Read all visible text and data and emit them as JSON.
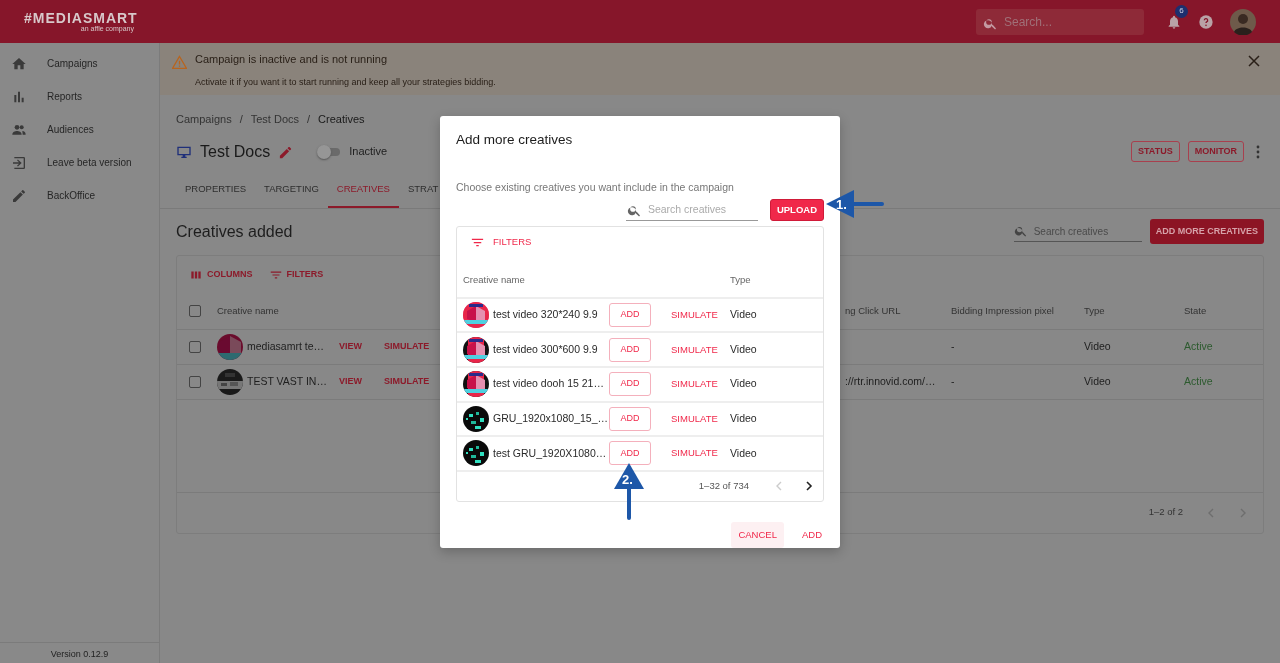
{
  "topbar": {
    "logo": "#MEDIASMART",
    "logo_tagline": "an affle company",
    "search": {
      "placeholder": "Search..."
    },
    "notifications_badge": "6"
  },
  "sidebar": {
    "items": [
      {
        "label": "Campaigns",
        "kind": "home"
      },
      {
        "label": "Reports",
        "kind": "chart"
      },
      {
        "label": "Audiences",
        "kind": "people"
      },
      {
        "label": "Leave beta version",
        "kind": "exit"
      },
      {
        "label": "BackOffice",
        "kind": "pencil"
      }
    ],
    "version": "Version 0.12.9"
  },
  "banner": {
    "title": "Campaign is inactive and is not running",
    "message": "Activate it if you want it to start running and keep all your strategies bidding."
  },
  "breadcrumb": {
    "items": [
      "Campaigns",
      "Test Docs",
      "Creatives"
    ],
    "separators": [
      "/",
      "/"
    ]
  },
  "campaign": {
    "title": "Test Docs",
    "active": false,
    "status_label": "Inactive"
  },
  "header_buttons": [
    "STATUS",
    "MONITOR"
  ],
  "tabs": [
    {
      "label": "PROPERTIES",
      "selected": false
    },
    {
      "label": "TARGETING",
      "selected": false
    },
    {
      "label": "CREATIVES",
      "selected": true
    },
    {
      "label": "STRAT",
      "selected": false
    }
  ],
  "section": {
    "title": "Creatives added",
    "search": {
      "placeholder": "Search creatives"
    },
    "add_button": "ADD MORE CREATIVES",
    "toolbar": [
      {
        "label": "COLUMNS",
        "kind": "columns"
      },
      {
        "label": "FILTERS",
        "kind": "filter"
      }
    ]
  },
  "table": {
    "select_all": {
      "checked": false
    },
    "columns": [
      "Creative name",
      "ng Click URL",
      "Bidding Impression pixel",
      "Type",
      "State"
    ],
    "rows": [
      {
        "checked": false,
        "name": "mediasamrt te…",
        "actions": [
          "VIEW",
          "SIMULATE"
        ],
        "click_url": "",
        "impression_pixel": "-",
        "type": "Video",
        "state": "Active"
      },
      {
        "checked": false,
        "name": "TEST VAST IN…",
        "actions": [
          "VIEW",
          "SIMULATE"
        ],
        "click_url": "://rtr.innovid.com/…",
        "impression_pixel": "-",
        "type": "Video",
        "state": "Active"
      }
    ],
    "pagination": "1–2 of 2"
  },
  "dialog": {
    "title": "Add more creatives",
    "subtitle": "Choose existing creatives you want include in the campaign",
    "search": {
      "placeholder": "Search creatives"
    },
    "upload_button": "UPLOAD",
    "filters_label": "FILTERS",
    "columns": [
      "Creative name",
      "Type"
    ],
    "rows": [
      {
        "name": "test video 320*240 9.9",
        "add": "ADD",
        "simulate": "SIMULATE",
        "type": "Video"
      },
      {
        "name": "test video 300*600 9.9",
        "add": "ADD",
        "simulate": "SIMULATE",
        "type": "Video"
      },
      {
        "name": "test video dooh 15 21…",
        "add": "ADD",
        "simulate": "SIMULATE",
        "type": "Video"
      },
      {
        "name": "GRU_1920x1080_15_…",
        "add": "ADD",
        "simulate": "SIMULATE",
        "type": "Video"
      },
      {
        "name": "test GRU_1920X1080…",
        "add": "ADD",
        "simulate": "SIMULATE",
        "type": "Video"
      }
    ],
    "pagination": "1–32 of 734",
    "buttons": [
      "CANCEL",
      "ADD"
    ]
  },
  "annotations": [
    {
      "label": "1.",
      "kind": "left"
    },
    {
      "label": "2.",
      "kind": "up"
    }
  ]
}
